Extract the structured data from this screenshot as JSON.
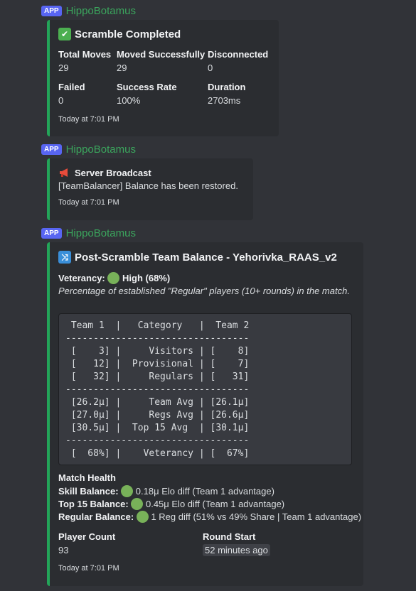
{
  "messages": [
    {
      "app_badge": "APP",
      "author": "HippoBotamus",
      "embed": {
        "title": "Scramble Completed",
        "fields": [
          {
            "name": "Total Moves",
            "value": "29"
          },
          {
            "name": "Moved Successfully",
            "value": "29"
          },
          {
            "name": "Disconnected",
            "value": "0"
          },
          {
            "name": "Failed",
            "value": "0"
          },
          {
            "name": "Success Rate",
            "value": "100%"
          },
          {
            "name": "Duration",
            "value": "2703ms"
          }
        ],
        "footer": "Today at 7:01 PM"
      }
    },
    {
      "app_badge": "APP",
      "author": "HippoBotamus",
      "embed": {
        "title": "Server Broadcast",
        "description": "[TeamBalancer] Balance has been restored.",
        "footer": "Today at 7:01 PM"
      }
    },
    {
      "app_badge": "APP",
      "author": "HippoBotamus",
      "embed": {
        "title": "Post-Scramble Team Balance - Yehorivka_RAAS_v2",
        "veterancy_label": "Veterancy:",
        "veterancy_value": "High (68%)",
        "veterancy_note": "Percentage of established \"Regular\" players (10+ rounds) in the match.",
        "code_lines": [
          " Team 1  |   Category   |  Team 2",
          "---------------------------------",
          " [    3] |     Visitors | [    8]",
          " [   12] |  Provisional | [    7]",
          " [   32] |     Regulars | [   31]",
          "---------------------------------",
          " [26.2μ] |     Team Avg | [26.1μ]",
          " [27.0μ] |     Regs Avg | [26.6μ]",
          " [30.5μ] |  Top 15 Avg  | [30.1μ]",
          "---------------------------------",
          " [  68%] |    Veterancy | [  67%]"
        ],
        "match_health_title": "Match Health",
        "health": [
          {
            "label": "Skill Balance:",
            "value": "0.18μ Elo diff (Team 1 advantage)"
          },
          {
            "label": "Top 15 Balance:",
            "value": "0.45μ Elo diff (Team 1 advantage)"
          },
          {
            "label": "Regular Balance:",
            "value": "1 Reg diff (51% vs 49% Share | Team 1 advantage)"
          }
        ],
        "player_count_label": "Player Count",
        "player_count_value": "93",
        "round_start_label": "Round Start",
        "round_start_value": "52 minutes ago",
        "footer": "Today at 7:01 PM"
      }
    }
  ],
  "colors": {
    "accent": "#23a559",
    "app_badge": "#5865f2",
    "author": "#3ba55d",
    "status_dot": "#78b159"
  },
  "icons": {
    "check": "white-check-mark-icon",
    "megaphone": "megaphone-icon",
    "shuffle": "shuffle-icon",
    "dot": "green-circle-icon"
  }
}
